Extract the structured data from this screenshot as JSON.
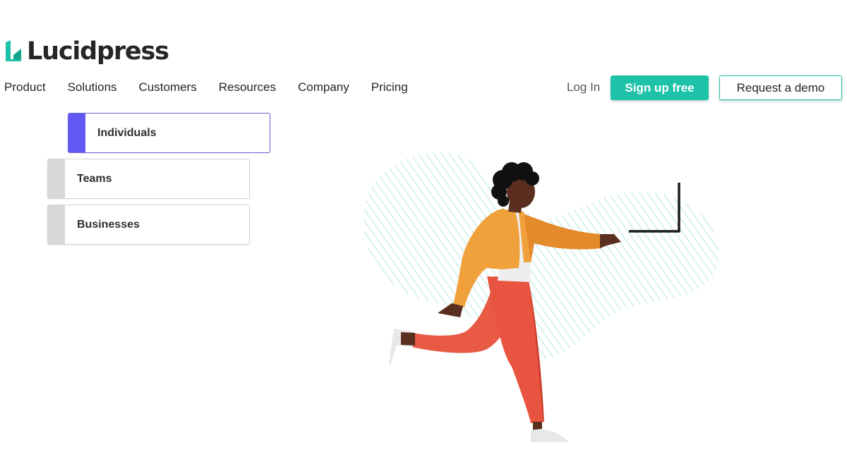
{
  "brand": {
    "name": "Lucidpress",
    "accent": "#1ec2a8",
    "active_accent": "#6259f5"
  },
  "nav": {
    "items": [
      {
        "label": "Product"
      },
      {
        "label": "Solutions"
      },
      {
        "label": "Customers"
      },
      {
        "label": "Resources"
      },
      {
        "label": "Company"
      },
      {
        "label": "Pricing"
      }
    ]
  },
  "header_actions": {
    "login": "Log In",
    "signup": "Sign up free",
    "demo": "Request a demo"
  },
  "segments": {
    "selected": "Individuals",
    "items": [
      {
        "label": "Individuals"
      },
      {
        "label": "Teams"
      },
      {
        "label": "Businesses"
      }
    ]
  },
  "illustration": {
    "icon": "person-pointing-illustration"
  }
}
